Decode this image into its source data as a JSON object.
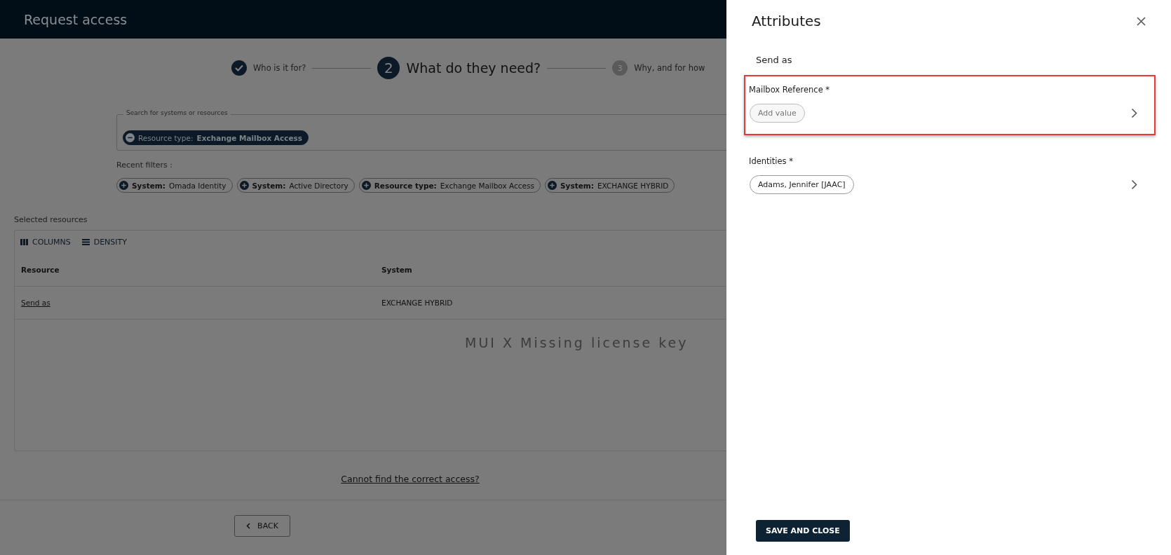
{
  "header": {
    "title": "Request access"
  },
  "stepper": [
    {
      "label": "Who is it for?",
      "done": true,
      "active": false
    },
    {
      "label": "What do they need?",
      "done": false,
      "active": true,
      "number": "2"
    },
    {
      "label": "Why, and for how",
      "done": false,
      "active": false,
      "number": "3"
    }
  ],
  "search": {
    "label": "Search for systems or resources",
    "chips": [
      {
        "key": "Resource type:",
        "value": "Exchange Mailbox Access"
      }
    ]
  },
  "recent_filters": {
    "label": "Recent filters :",
    "chips": [
      {
        "key": "System:",
        "value": "Omada Identity"
      },
      {
        "key": "System:",
        "value": "Active Directory"
      },
      {
        "key": "Resource type:",
        "value": "Exchange Mailbox Access"
      },
      {
        "key": "System:",
        "value": "EXCHANGE HYBRID"
      }
    ]
  },
  "selected_resources": {
    "label": "Selected resources",
    "toolbar": [
      "COLUMNS",
      "DENSITY"
    ],
    "columns": [
      "Resource",
      "System"
    ],
    "rows": [
      {
        "resource": "Send as",
        "system": "EXCHANGE HYBRID"
      }
    ],
    "notice": "MUI X Missing license key"
  },
  "help_link": "Cannot find the correct access?",
  "back_button": "BACK",
  "drawer": {
    "title": "Attributes",
    "subtitle": "Send as",
    "fields": [
      {
        "label": "Mailbox Reference *",
        "highlighted": true,
        "chips": [
          {
            "text": "Add value",
            "kind": "placeholder"
          }
        ]
      },
      {
        "label": "Identities *",
        "highlighted": false,
        "chips": [
          {
            "text": "Adams, Jennifer [JAAC]",
            "kind": "value"
          }
        ]
      }
    ],
    "save_button": "SAVE AND CLOSE"
  }
}
